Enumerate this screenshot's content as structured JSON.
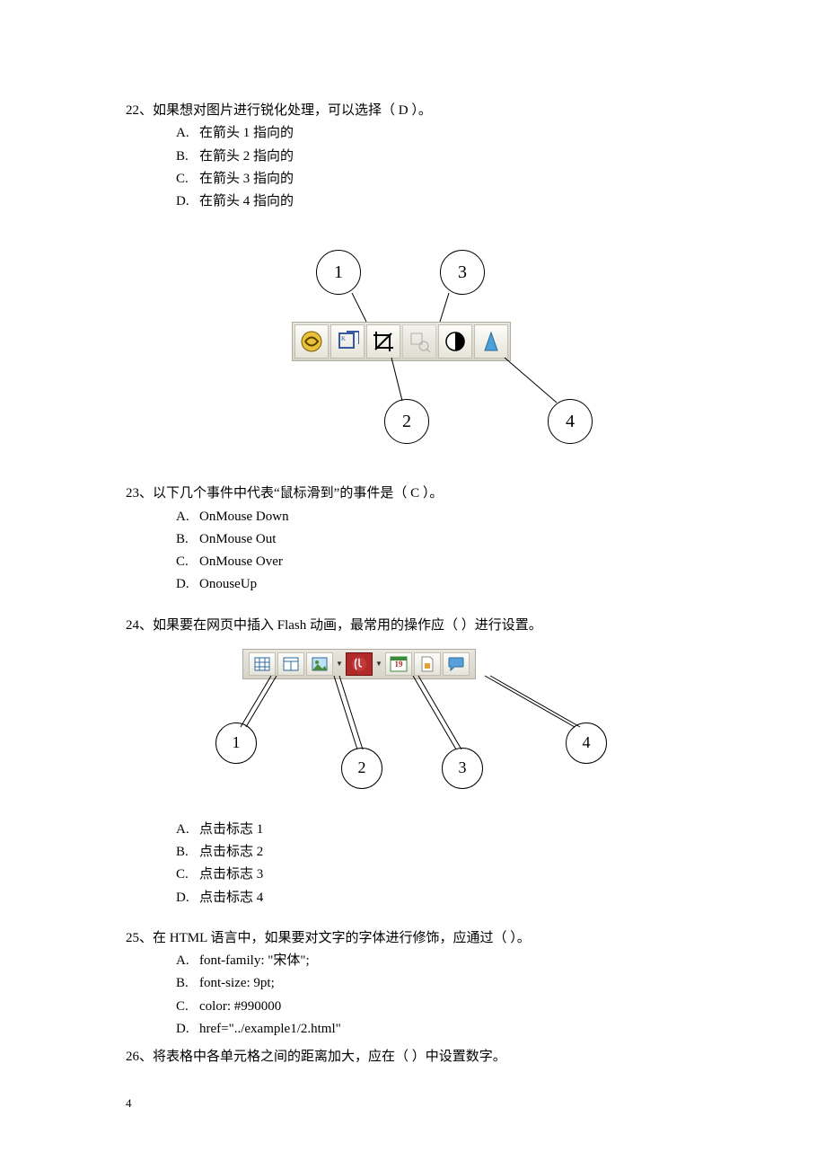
{
  "q22": {
    "number": "22、",
    "text": "如果想对图片进行锐化处理，可以选择（   D   ）。",
    "options": {
      "A": "在箭头 1 指向的",
      "B": "在箭头 2 指向的",
      "C": "在箭头 3 指向的",
      "D": "在箭头 4 指向的"
    },
    "callouts": {
      "c1": "1",
      "c2": "2",
      "c3": "3",
      "c4": "4"
    }
  },
  "q23": {
    "number": "23、",
    "text": "以下几个事件中代表“鼠标滑到”的事件是（   C   ）。",
    "options": {
      "A": "OnMouse Down",
      "B": "OnMouse Out",
      "C": "OnMouse Over",
      "D": "OnouseUp"
    }
  },
  "q24": {
    "number": "24、",
    "text": "如果要在网页中插入 Flash 动画，最常用的操作应（       ）进行设置。",
    "options": {
      "A": "点击标志 1",
      "B": "点击标志 2",
      "C": "点击标志 3",
      "D": "点击标志 4"
    },
    "callouts": {
      "c1": "1",
      "c2": "2",
      "c3": "3",
      "c4": "4"
    },
    "calendar_day": "19"
  },
  "q25": {
    "number": "25、",
    "text": "在 HTML 语言中，如果要对文字的字体进行修饰，应通过（       ）。",
    "options": {
      "A": "font-family: \"宋体\";",
      "B": "font-size: 9pt;",
      "C": "color: #990000",
      "D": "href=\"../example1/2.html\""
    }
  },
  "q26": {
    "number": "26、",
    "text": "将表格中各单元格之间的距离加大，应在（       ）中设置数字。"
  },
  "page_number": "4"
}
